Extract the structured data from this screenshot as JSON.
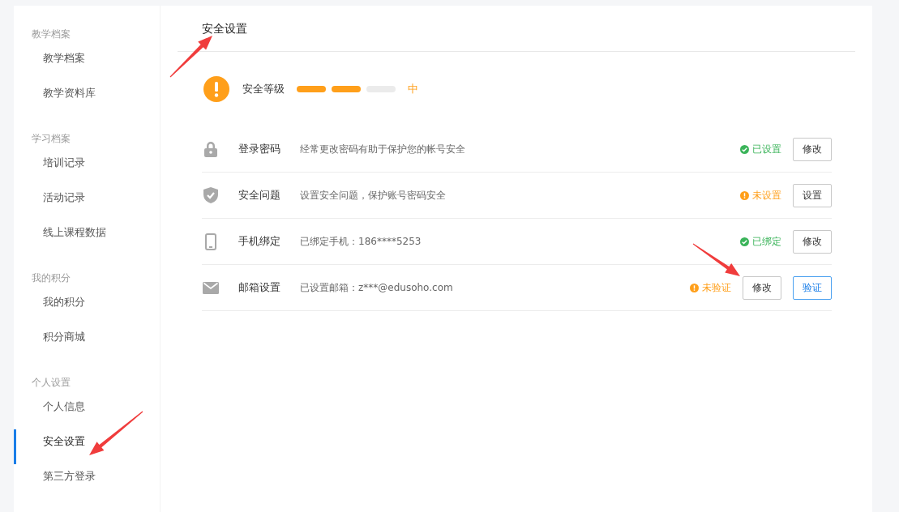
{
  "sidebar": {
    "groups": [
      {
        "title": "教学档案",
        "items": [
          {
            "label": "教学档案",
            "selected": false
          },
          {
            "label": "教学资料库",
            "selected": false
          }
        ]
      },
      {
        "title": "学习档案",
        "items": [
          {
            "label": "培训记录",
            "selected": false
          },
          {
            "label": "活动记录",
            "selected": false
          },
          {
            "label": "线上课程数据",
            "selected": false
          }
        ]
      },
      {
        "title": "我的积分",
        "items": [
          {
            "label": "我的积分",
            "selected": false
          },
          {
            "label": "积分商城",
            "selected": false
          }
        ]
      },
      {
        "title": "个人设置",
        "items": [
          {
            "label": "个人信息",
            "selected": false
          },
          {
            "label": "安全设置",
            "selected": true
          },
          {
            "label": "第三方登录",
            "selected": false
          }
        ]
      }
    ]
  },
  "page_title": "安全设置",
  "security_level": {
    "label": "安全等级",
    "level": 0.67,
    "reading": "中"
  },
  "settings": [
    {
      "kind": "password",
      "name": "登录密码",
      "description": "经常更改密码有助于保护您的帐号安全",
      "status": {
        "kind": "ok",
        "text": "已设置"
      },
      "buttons": [
        {
          "label": "修改",
          "kind": "default"
        }
      ]
    },
    {
      "kind": "question",
      "name": "安全问题",
      "description": "设置安全问题，保护账号密码安全",
      "status": {
        "kind": "warn",
        "text": "未设置"
      },
      "buttons": [
        {
          "label": "设置",
          "kind": "default"
        }
      ]
    },
    {
      "kind": "phone",
      "name": "手机绑定",
      "description": "已绑定手机：186****5253",
      "status": {
        "kind": "ok",
        "text": "已绑定"
      },
      "buttons": [
        {
          "label": "修改",
          "kind": "default"
        }
      ]
    },
    {
      "kind": "email",
      "name": "邮箱设置",
      "description": "已设置邮箱：z***@edusoho.com",
      "status": {
        "kind": "warn",
        "text": "未验证"
      },
      "buttons": [
        {
          "label": "修改",
          "kind": "default"
        },
        {
          "label": "验证",
          "kind": "primary"
        }
      ]
    }
  ]
}
